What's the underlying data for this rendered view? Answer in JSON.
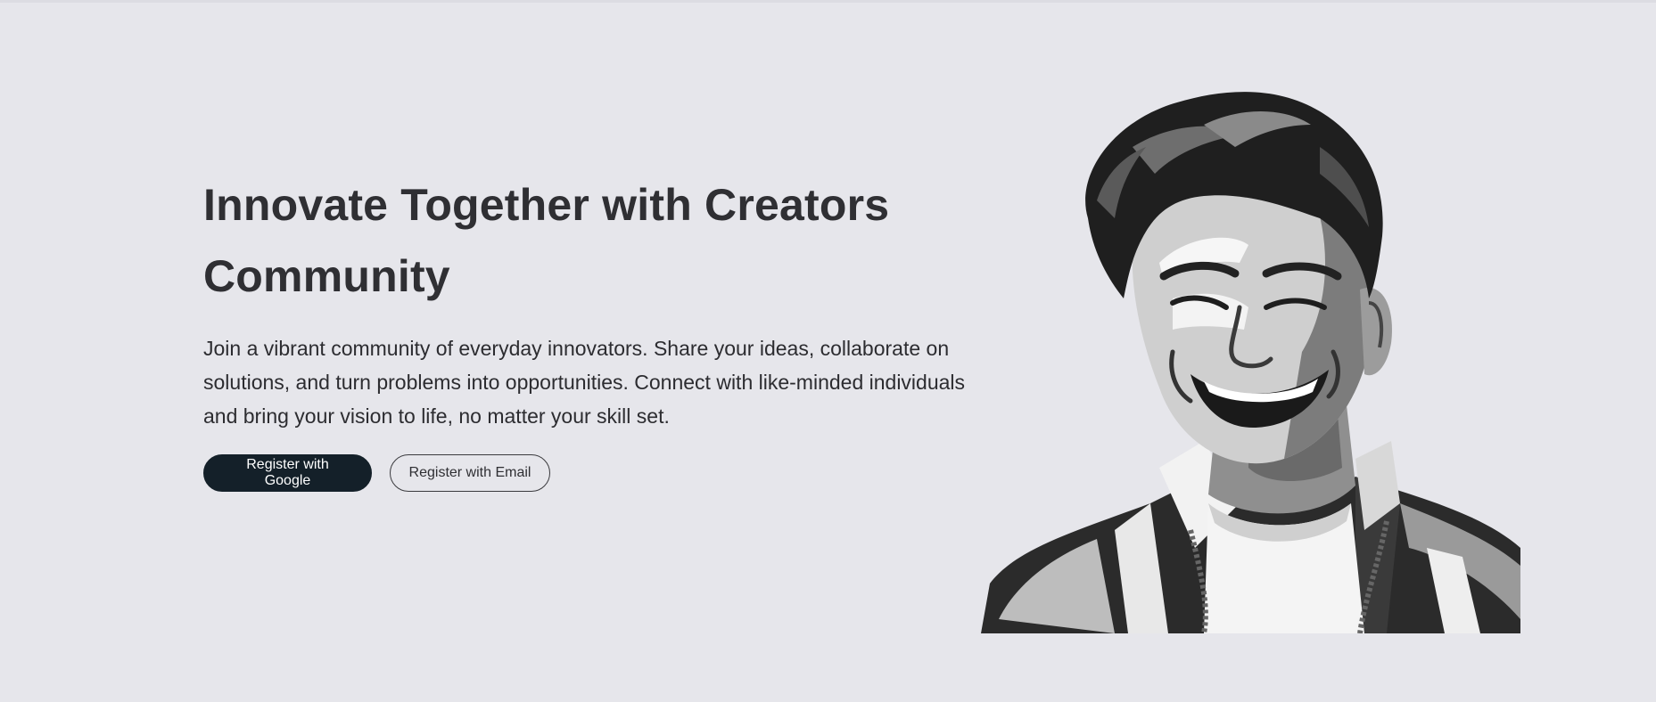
{
  "hero": {
    "title": "Innovate Together with Creators Community",
    "description": "Join a vibrant community of everyday innovators. Share your ideas, collaborate on solutions, and turn problems into opportunities. Connect with like-minded individuals and bring your vision to life, no matter your skill set.",
    "buttons": {
      "google_label": "Register with Google",
      "email_label": "Register with Email"
    }
  },
  "illustration": {
    "icon": "smiling-man-portrait-illustration"
  },
  "colors": {
    "background": "#e6e6eb",
    "text": "#2f2f33",
    "primary_button": "#142029"
  }
}
